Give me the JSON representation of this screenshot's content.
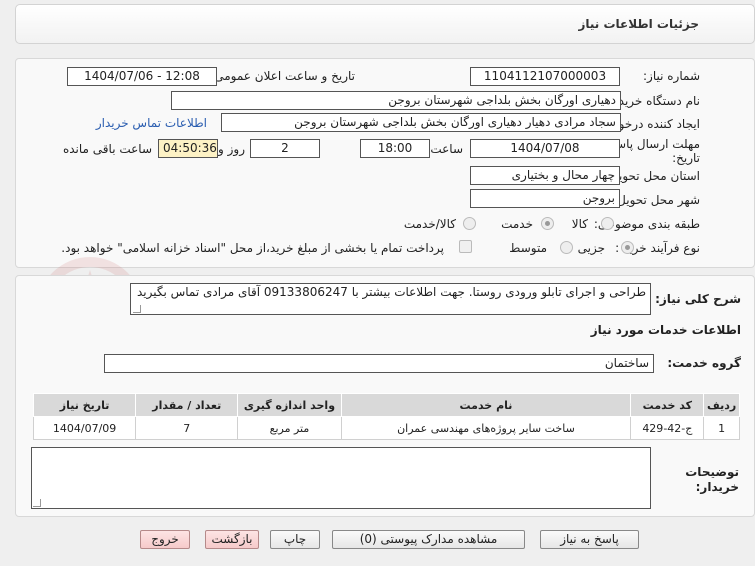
{
  "header": {
    "title": "جزئیات اطلاعات نیاز"
  },
  "form": {
    "need_number_label": "شماره نیاز:",
    "need_number": "1104112107000003",
    "announce_label": "تاریخ و ساعت اعلان عمومی:",
    "announce_value": "1404/07/06 - 12:08",
    "buyer_org_label": "نام دستگاه خریدار:",
    "buyer_org": "دهیاری اورگان بخش بلداجی شهرستان بروجن",
    "creator_label": "ایجاد کننده درخواست:",
    "creator": "سجاد مرادی دهیار دهیاری اورگان بخش بلداجی شهرستان بروجن",
    "contact_link": "اطلاعات تماس خریدار",
    "deadline_label_1": "مهلت ارسال پاسخ: تا",
    "deadline_label_2": "تاریخ:",
    "deadline_date": "1404/07/08",
    "time_label": "ساعت",
    "deadline_time": "18:00",
    "days": "2",
    "days_label": "روز و",
    "remaining": "04:50:36",
    "remaining_label": "ساعت باقی مانده",
    "province_label": "استان محل تحویل:",
    "province": "چهار محال و بختیاری",
    "city_label": "شهر محل تحویل:",
    "city": "بروجن",
    "category_label": "طبقه بندی موضوعی:",
    "category_options": [
      "کالا",
      "خدمت",
      "کالا/خدمت"
    ],
    "process_label": "نوع فرآیند خرید :",
    "process_options": [
      "جزیی",
      "متوسط"
    ],
    "payment_note": "پرداخت تمام یا بخشی از مبلغ خرید،از محل \"اسناد خزانه اسلامی\" خواهد بود."
  },
  "description": {
    "label": "شرح کلی نیاز:",
    "value": "طراحی و اجرای تابلو ورودی روستا. جهت اطلاعات بیشتر با 09133806247 آقای مرادی تماس بگیرید"
  },
  "services": {
    "title": "اطلاعات خدمات مورد نیاز",
    "group_label": "گروه خدمت:",
    "group_value": "ساختمان",
    "columns": [
      "ردیف",
      "کد خدمت",
      "نام خدمت",
      "واحد اندازه گیری",
      "تعداد / مقدار",
      "تاریخ نیاز"
    ],
    "rows": [
      [
        "1",
        "ج-42-429",
        "ساخت سایر پروژه‌های مهندسی عمران",
        "متر مربع",
        "7",
        "1404/07/09"
      ]
    ]
  },
  "buyer_notes": {
    "label_1": "توضیحات",
    "label_2": "خریدار:",
    "value": ""
  },
  "buttons": {
    "respond": "پاسخ به نیاز",
    "attachments": "مشاهده مدارک پیوستی (0)",
    "print": "چاپ",
    "back": "بازگشت",
    "exit": "خروج"
  },
  "watermark": {
    "text": "AriaTender.neT"
  }
}
